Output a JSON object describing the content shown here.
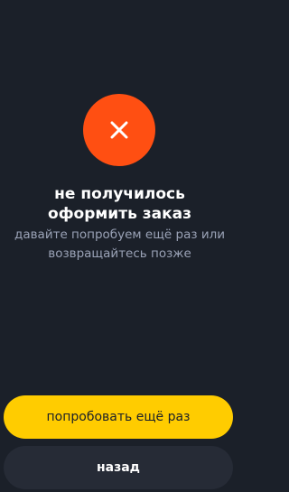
{
  "colors": {
    "background": "#1b2029",
    "status": "#ff4f12",
    "primary_button": "#ffcc00",
    "secondary_button": "#262b36",
    "subtitle_text": "#9aa2b6"
  },
  "status": {
    "icon": "close-icon"
  },
  "message": {
    "title": "не получилось оформить заказ",
    "subtitle": "давайте попробуем ещё раз или возвращайтесь позже"
  },
  "actions": {
    "retry_label": "попробовать ещё раз",
    "back_label": "назад"
  }
}
